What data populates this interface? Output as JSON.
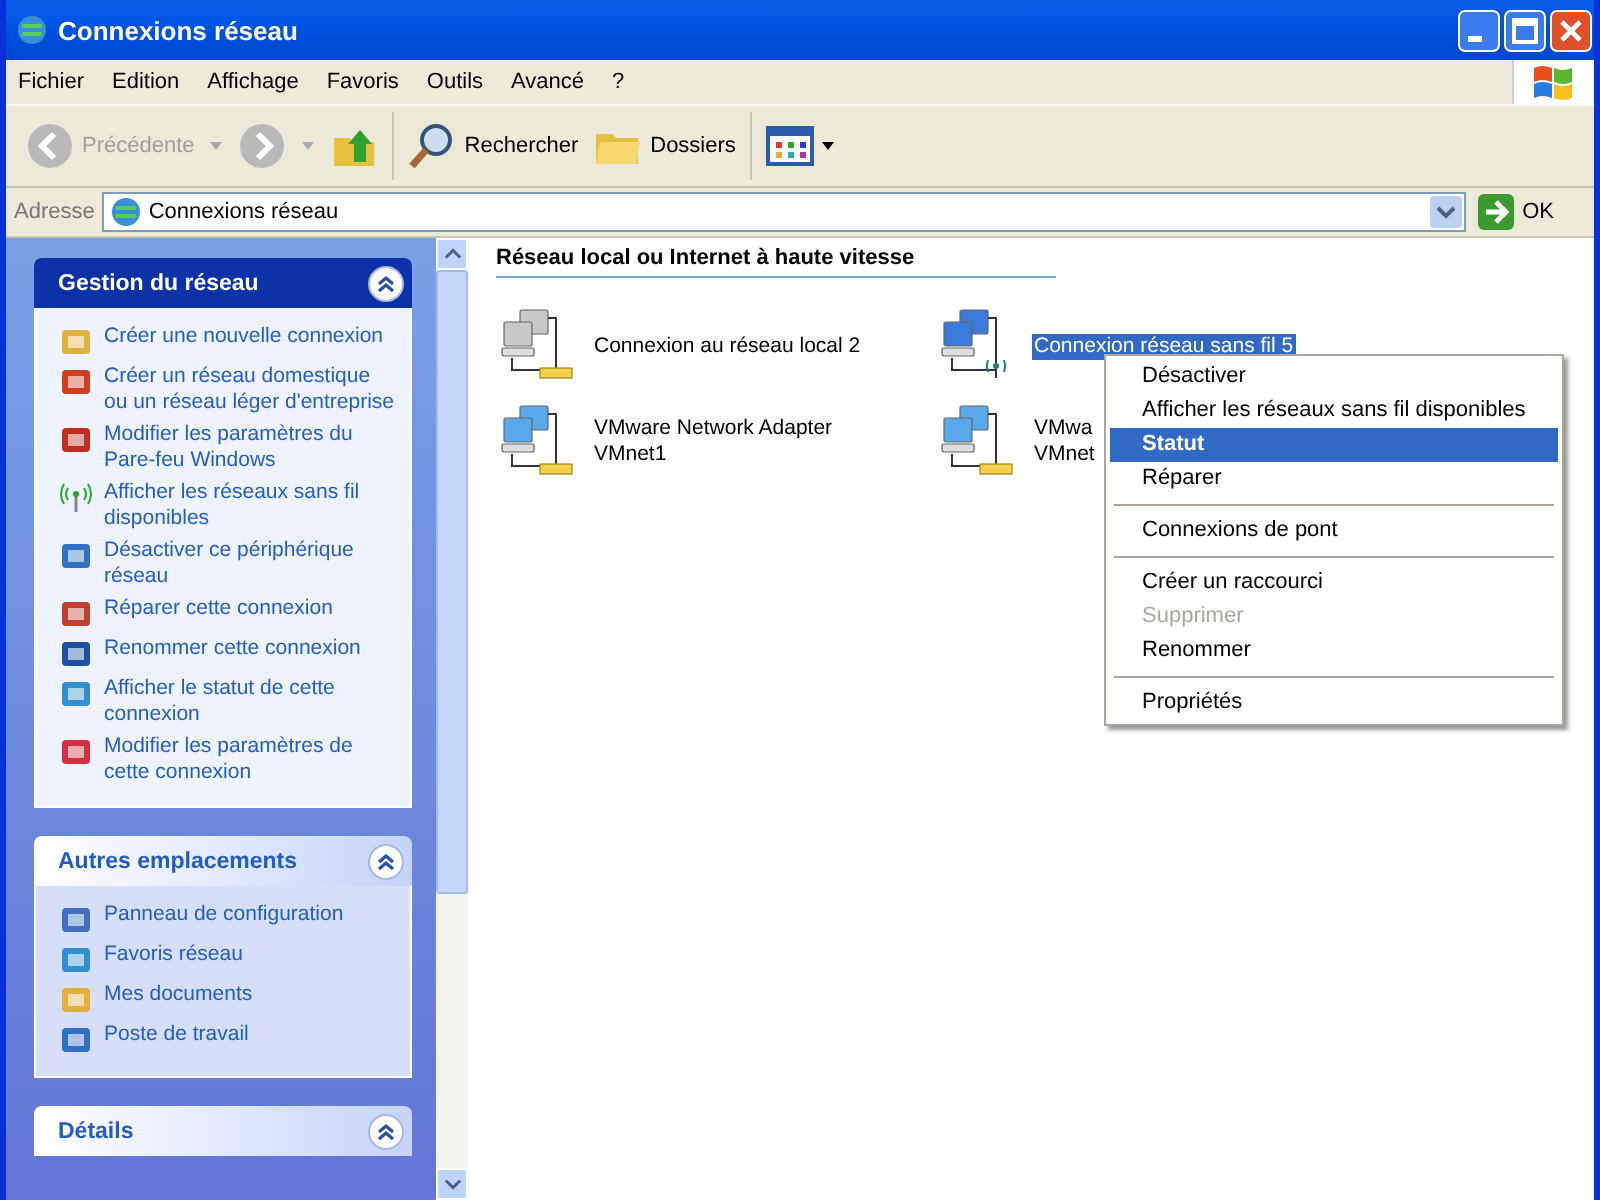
{
  "window": {
    "title": "Connexions réseau"
  },
  "menu_bar": [
    "Fichier",
    "Edition",
    "Affichage",
    "Favoris",
    "Outils",
    "Avancé",
    "?"
  ],
  "toolbar": {
    "back": {
      "label": "Précédente",
      "disabled": true
    },
    "search": "Rechercher",
    "folders": "Dossiers"
  },
  "address_bar": {
    "label": "Adresse",
    "value": "Connexions réseau",
    "go": "OK"
  },
  "task_panels": [
    {
      "title": "Gestion du réseau",
      "items": [
        {
          "label": "Créer une nouvelle connexion",
          "kind": "wizard"
        },
        {
          "label": "Créer un réseau domestique ou un réseau léger d'entreprise",
          "kind": "home"
        },
        {
          "label": "Modifier les paramètres du Pare-feu Windows",
          "kind": "firewall"
        },
        {
          "label": "Afficher les réseaux sans fil disponibles",
          "kind": "wireless"
        },
        {
          "label": "Désactiver ce périphérique réseau",
          "kind": "disable"
        },
        {
          "label": "Réparer cette connexion",
          "kind": "repair"
        },
        {
          "label": "Renommer cette connexion",
          "kind": "rename"
        },
        {
          "label": "Afficher le statut de cette connexion",
          "kind": "status"
        },
        {
          "label": "Modifier les paramètres de cette connexion",
          "kind": "settings"
        }
      ]
    },
    {
      "title": "Autres emplacements",
      "items": [
        {
          "label": "Panneau de configuration",
          "kind": "control"
        },
        {
          "label": "Favoris réseau",
          "kind": "network"
        },
        {
          "label": "Mes documents",
          "kind": "documents"
        },
        {
          "label": "Poste de travail",
          "kind": "computer"
        }
      ]
    },
    {
      "title": "Détails"
    }
  ],
  "group_header": "Réseau local ou Internet à haute vitesse",
  "connections": [
    {
      "lines": [
        "Connexion au réseau local 2"
      ],
      "kind": "wired",
      "disabled": true,
      "selected": false
    },
    {
      "lines": [
        "Connexion réseau sans fil 5"
      ],
      "kind": "wireless",
      "disabled": false,
      "selected": true
    },
    {
      "lines": [
        "VMware Network Adapter",
        "VMnet1"
      ],
      "kind": "wired",
      "disabled": false,
      "selected": false
    },
    {
      "lines": [
        "VMwa",
        "VMnet"
      ],
      "kind": "wired",
      "disabled": false,
      "selected": false
    }
  ],
  "context_menu": [
    {
      "kind": "item",
      "label": "Désactiver",
      "disabled": false,
      "selected": false
    },
    {
      "kind": "item",
      "label": "Afficher les réseaux sans fil disponibles",
      "disabled": false,
      "selected": false
    },
    {
      "kind": "item",
      "label": "Statut",
      "disabled": false,
      "selected": true
    },
    {
      "kind": "item",
      "label": "Réparer",
      "disabled": false,
      "selected": false
    },
    {
      "kind": "separator"
    },
    {
      "kind": "item",
      "label": "Connexions de pont",
      "disabled": false,
      "selected": false
    },
    {
      "kind": "separator"
    },
    {
      "kind": "item",
      "label": "Créer un raccourci",
      "disabled": false,
      "selected": false
    },
    {
      "kind": "item",
      "label": "Supprimer",
      "disabled": true,
      "selected": false
    },
    {
      "kind": "item",
      "label": "Renommer",
      "disabled": false,
      "selected": false
    },
    {
      "kind": "separator"
    },
    {
      "kind": "item",
      "label": "Propriétés",
      "disabled": false,
      "selected": false
    }
  ]
}
